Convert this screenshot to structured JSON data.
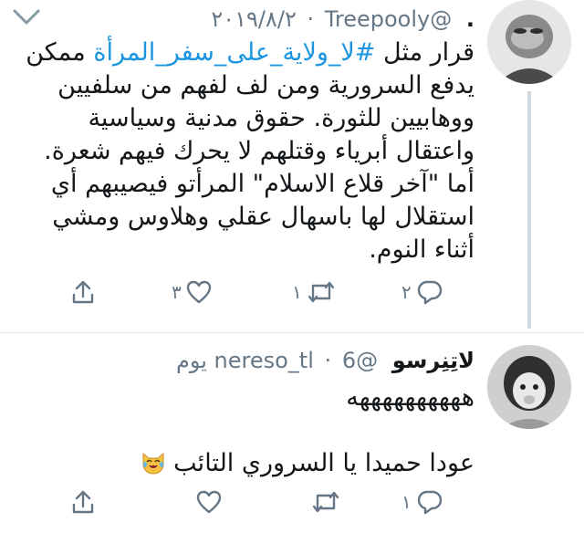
{
  "tweet1": {
    "display_name": ".",
    "handle": "@Treepooly",
    "separator": "·",
    "date": "٢٠١٩/٨/٢",
    "text_pre": "قرار مثل ",
    "hashtag": "#لا_ولاية_على_سفر_المرأة",
    "text_post": " ممكن يدفع السرورية ومن لف لفهم من سلفيين ووهابيين للثورة. حقوق مدنية وسياسية واعتقال أبرياء وقتلهم لا يحرك فيهم شعرة. أما \"آخر قلاع الاسلام\" المرأتو فيصيبهم أي استقلال لها باسهال عقلي وهلاوس ومشي أثناء النوم.",
    "reply_count": "٢",
    "retweet_count": "١",
    "like_count": "٣"
  },
  "tweet2": {
    "display_name": "لاتِنِرسو",
    "handle": "@nereso_tl",
    "separator": "·",
    "date": "6 يوم",
    "line1": "ههههههههههه",
    "line2": "عودا حميدا يا السروري التائب",
    "reply_count": "١",
    "retweet_count": "",
    "like_count": ""
  },
  "icons": {
    "reply": "reply-icon",
    "retweet": "retweet-icon",
    "like": "heart-icon",
    "share": "share-icon",
    "more": "chevron-down-icon",
    "emoji": "tears-of-joy-cat-emoji"
  },
  "colors": {
    "hashtag": "#1b95e0",
    "secondary_text": "#657786",
    "primary_text": "#14171a",
    "thread_line": "#cfd9de"
  }
}
